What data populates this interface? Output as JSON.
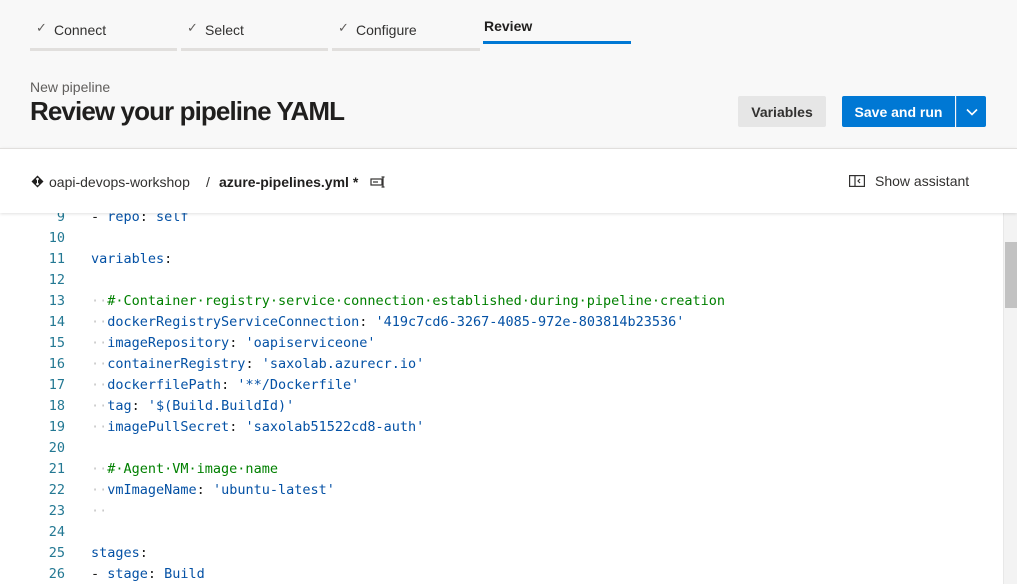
{
  "wizard": {
    "steps": [
      {
        "label": "Connect",
        "done": true
      },
      {
        "label": "Select",
        "done": true
      },
      {
        "label": "Configure",
        "done": true
      },
      {
        "label": "Review",
        "active": true
      }
    ]
  },
  "header": {
    "subtitle": "New pipeline",
    "title": "Review your pipeline YAML",
    "variables_label": "Variables",
    "save_run_label": "Save and run"
  },
  "pathbar": {
    "repo": "oapi-devops-workshop",
    "separator": "/",
    "file": "azure-pipelines.yml *",
    "assistant_label": "Show assistant"
  },
  "editor": {
    "lines": [
      {
        "n": "9",
        "tokens": [
          [
            "pun",
            "- "
          ],
          [
            "key",
            "repo"
          ],
          [
            "pun",
            ": "
          ],
          [
            "val",
            "self"
          ]
        ]
      },
      {
        "n": "10",
        "tokens": []
      },
      {
        "n": "11",
        "tokens": [
          [
            "key",
            "variables"
          ],
          [
            "pun",
            ":"
          ]
        ]
      },
      {
        "n": "12",
        "tokens": []
      },
      {
        "n": "13",
        "tokens": [
          [
            "ws",
            "··"
          ],
          [
            "com",
            "#·Container·registry·service·connection·established·during·pipeline·creation"
          ]
        ]
      },
      {
        "n": "14",
        "tokens": [
          [
            "ws",
            "··"
          ],
          [
            "key",
            "dockerRegistryServiceConnection"
          ],
          [
            "pun",
            ": "
          ],
          [
            "str",
            "'419c7cd6-3267-4085-972e-803814b23536'"
          ]
        ]
      },
      {
        "n": "15",
        "tokens": [
          [
            "ws",
            "··"
          ],
          [
            "key",
            "imageRepository"
          ],
          [
            "pun",
            ": "
          ],
          [
            "str",
            "'oapiserviceone'"
          ]
        ]
      },
      {
        "n": "16",
        "tokens": [
          [
            "ws",
            "··"
          ],
          [
            "key",
            "containerRegistry"
          ],
          [
            "pun",
            ": "
          ],
          [
            "str",
            "'saxolab.azurecr.io'"
          ]
        ]
      },
      {
        "n": "17",
        "tokens": [
          [
            "ws",
            "··"
          ],
          [
            "key",
            "dockerfilePath"
          ],
          [
            "pun",
            ": "
          ],
          [
            "str",
            "'**/Dockerfile'"
          ]
        ]
      },
      {
        "n": "18",
        "tokens": [
          [
            "ws",
            "··"
          ],
          [
            "key",
            "tag"
          ],
          [
            "pun",
            ": "
          ],
          [
            "str",
            "'$(Build.BuildId)'"
          ]
        ]
      },
      {
        "n": "19",
        "tokens": [
          [
            "ws",
            "··"
          ],
          [
            "key",
            "imagePullSecret"
          ],
          [
            "pun",
            ": "
          ],
          [
            "str",
            "'saxolab51522cd8-auth'"
          ]
        ]
      },
      {
        "n": "20",
        "tokens": []
      },
      {
        "n": "21",
        "tokens": [
          [
            "ws",
            "··"
          ],
          [
            "com",
            "#·Agent·VM·image·name"
          ]
        ]
      },
      {
        "n": "22",
        "tokens": [
          [
            "ws",
            "··"
          ],
          [
            "key",
            "vmImageName"
          ],
          [
            "pun",
            ": "
          ],
          [
            "str",
            "'ubuntu-latest'"
          ]
        ]
      },
      {
        "n": "23",
        "tokens": [
          [
            "ws",
            "··"
          ]
        ]
      },
      {
        "n": "24",
        "tokens": []
      },
      {
        "n": "25",
        "tokens": [
          [
            "key",
            "stages"
          ],
          [
            "pun",
            ":"
          ]
        ]
      },
      {
        "n": "26",
        "tokens": [
          [
            "pun",
            "- "
          ],
          [
            "key",
            "stage"
          ],
          [
            "pun",
            ": "
          ],
          [
            "val",
            "Build"
          ]
        ]
      }
    ]
  },
  "colors": {
    "accent": "#0078d4",
    "yaml_key": "#0451a5",
    "yaml_comment": "#008000",
    "line_number": "#237893"
  },
  "icons": {
    "step_done": "check-icon",
    "repo": "git-diamond-icon",
    "rename": "rename-icon",
    "assistant": "panel-icon",
    "dropdown": "chevron-down-icon"
  }
}
